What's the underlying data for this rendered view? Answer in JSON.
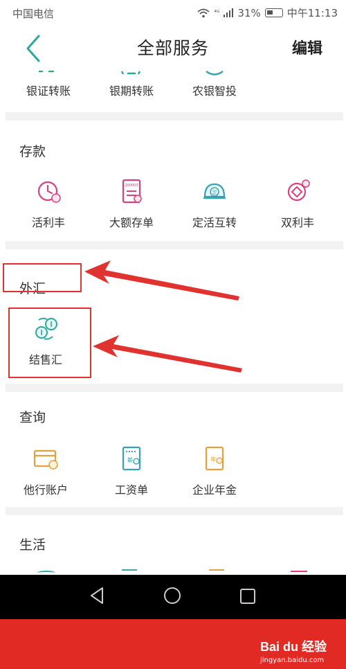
{
  "status_bar": {
    "carrier": "中国电信",
    "battery": "31%",
    "time": "中午11:13",
    "signal": "⁴ᴳ"
  },
  "header": {
    "title": "全部服务",
    "edit_label": "编辑"
  },
  "transfer_row": {
    "items": [
      "银证转账",
      "银期转账",
      "农银智投"
    ]
  },
  "deposit": {
    "title": "存款",
    "items": [
      "活利丰",
      "大额存单",
      "定活互转",
      "双利丰"
    ]
  },
  "forex": {
    "title": "外汇",
    "items": [
      "结售汇"
    ]
  },
  "query": {
    "title": "查询",
    "items": [
      "他行账户",
      "工资单",
      "企业年金"
    ]
  },
  "life": {
    "title": "生活"
  },
  "icon_text": {
    "dingqi": "定",
    "xin": "薪",
    "nian": "年",
    "big_deposit": "200000"
  },
  "watermark": {
    "brand": "Bai du 经验",
    "url": "jingyan.baidu.com"
  },
  "colors": {
    "accent_green": "#2aa89a",
    "icon_pink": "#d9417e",
    "icon_orange": "#e2a13c",
    "icon_teal": "#3aa1b0",
    "annotation_red": "#e0322f",
    "footer_red": "#e22a24"
  }
}
